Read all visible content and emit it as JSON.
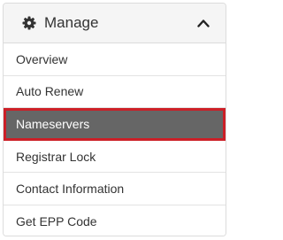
{
  "panel": {
    "title": "Manage",
    "header_icon": "gear-icon",
    "toggle_icon": "chevron-up-icon"
  },
  "menu": {
    "items": [
      {
        "label": "Overview",
        "active": false
      },
      {
        "label": "Auto Renew",
        "active": false
      },
      {
        "label": "Nameservers",
        "active": true
      },
      {
        "label": "Registrar Lock",
        "active": false
      },
      {
        "label": "Contact Information",
        "active": false
      },
      {
        "label": "Get EPP Code",
        "active": false
      }
    ]
  },
  "colors": {
    "active_background": "#666666",
    "active_border": "#cc1f27",
    "header_background": "#f5f5f5"
  }
}
